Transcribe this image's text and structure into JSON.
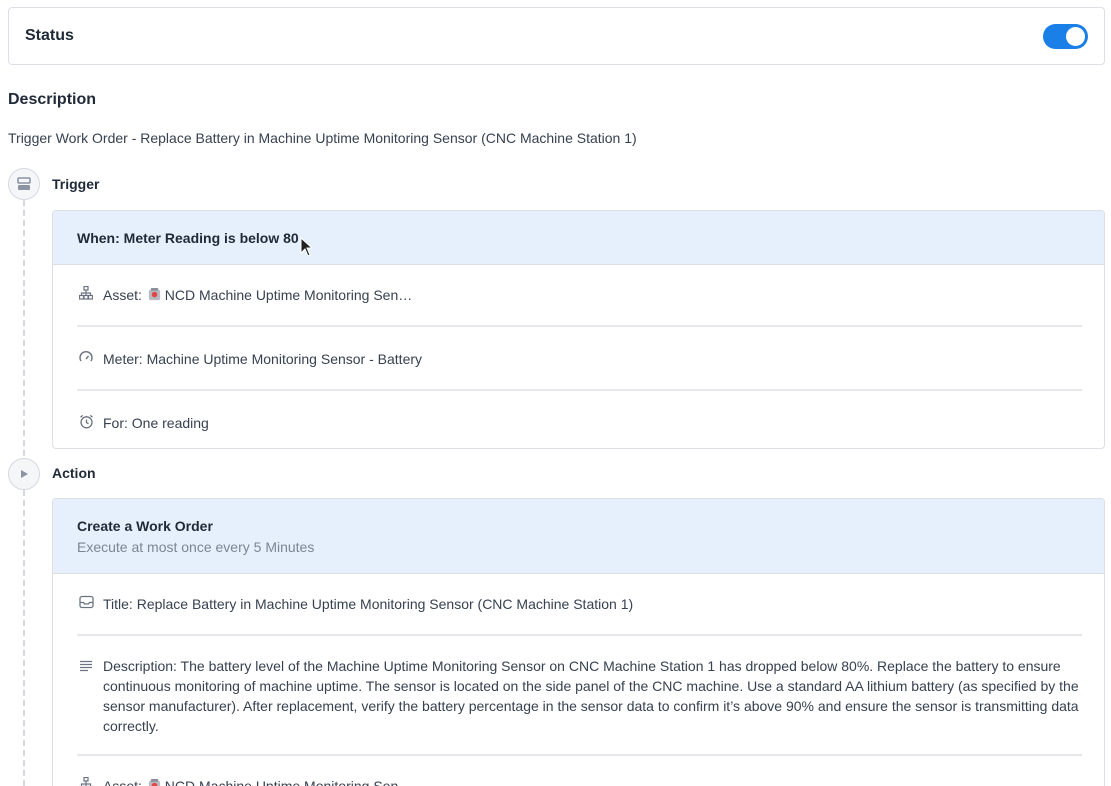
{
  "status": {
    "label": "Status",
    "enabled": true
  },
  "description": {
    "heading": "Description",
    "text": "Trigger Work Order - Replace Battery in Machine Uptime Monitoring Sensor (CNC Machine Station 1)"
  },
  "trigger": {
    "label": "Trigger",
    "icon": "trigger-icon",
    "header": "When: Meter Reading is below 80",
    "rows": [
      {
        "icon": "hierarchy-icon",
        "prefix": "Asset: ",
        "emoji": "sensor-emoji",
        "text": "NCD Machine Uptime Monitoring Sen…"
      },
      {
        "icon": "gauge-icon",
        "prefix": "",
        "text": "Meter: Machine Uptime Monitoring Sensor - Battery"
      },
      {
        "icon": "alarm-clock-icon",
        "prefix": "",
        "text": "For: One reading"
      }
    ]
  },
  "action": {
    "label": "Action",
    "icon": "play-icon",
    "header": "Create a Work Order",
    "subheader": "Execute at most once every 5 Minutes",
    "rows": [
      {
        "icon": "inbox-icon",
        "text": "Title: Replace Battery in Machine Uptime Monitoring Sensor (CNC Machine Station 1)"
      },
      {
        "icon": "text-lines-icon",
        "text": "Description: The battery level of the Machine Uptime Monitoring Sensor on CNC Machine Station 1 has dropped below 80%. Replace the battery to ensure continuous monitoring of machine uptime. The sensor is located on the side panel of the CNC machine. Use a standard AA lithium battery (as specified by the sensor manufacturer). After replacement, verify the battery percentage in the sensor data to confirm it’s above 90% and ensure the sensor is transmitting data correctly."
      },
      {
        "icon": "hierarchy-icon",
        "prefix": "Asset: ",
        "emoji": "sensor-emoji",
        "text": "NCD Machine Uptime Monitoring Sen…"
      }
    ]
  },
  "colors": {
    "accent": "#1a7fe6",
    "header_bg": "#e6f0fc",
    "border": "#dcdfe4"
  }
}
